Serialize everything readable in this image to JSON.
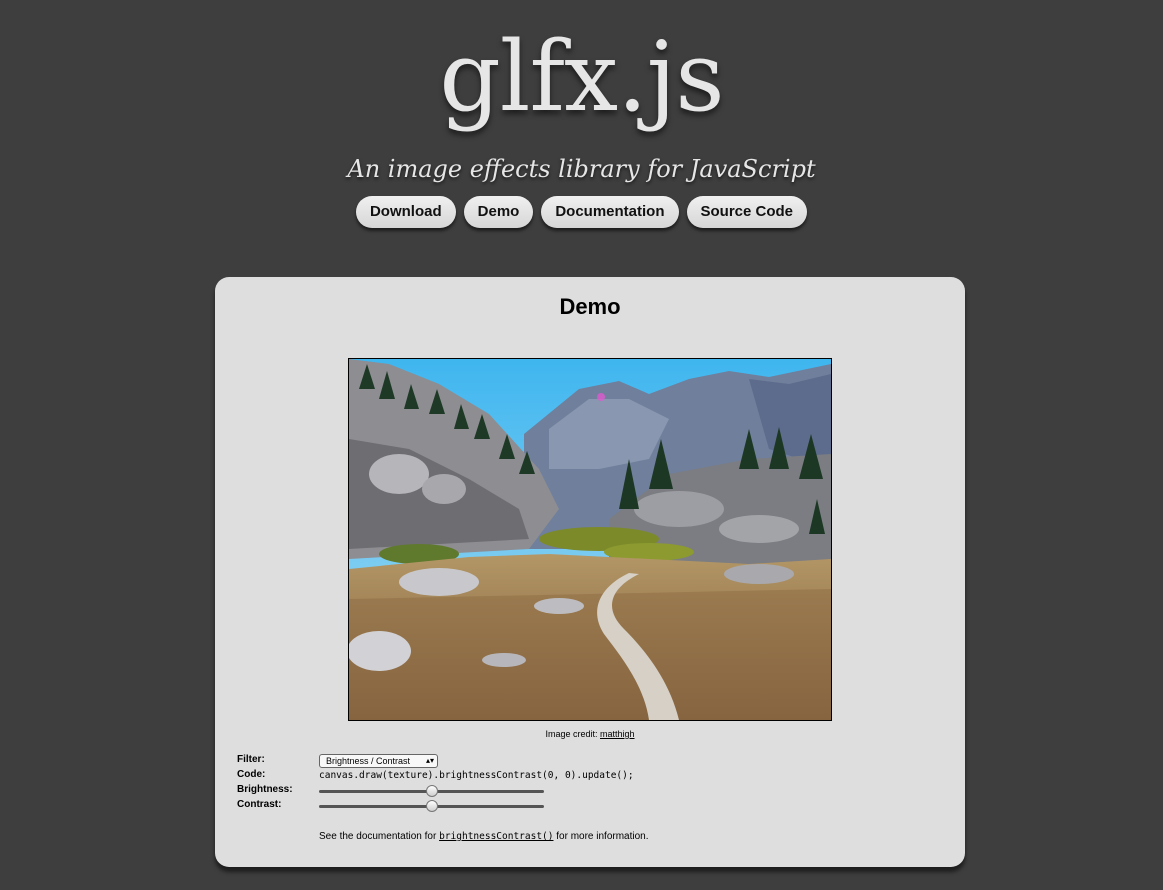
{
  "header": {
    "logo": "glfx.js",
    "tagline": "An image effects library for JavaScript",
    "nav": [
      "Download",
      "Demo",
      "Documentation",
      "Source Code"
    ]
  },
  "demo": {
    "title": "Demo",
    "image_credit_prefix": "Image credit:",
    "image_credit_author": "matthigh",
    "filter_label": "Filter:",
    "filter_selected": "Brightness / Contrast",
    "code_label": "Code:",
    "code": "canvas.draw(texture).brightnessContrast(0, 0).update();",
    "brightness_label": "Brightness:",
    "brightness_value": 0.5,
    "contrast_label": "Contrast:",
    "contrast_value": 0.5,
    "doc_prefix": "See the documentation for",
    "doc_link": "brightnessContrast()",
    "doc_suffix": "for more information."
  },
  "colors": {
    "background": "#3e3e3e",
    "panel": "#dedede",
    "logo_text": "#e6e6e6"
  }
}
